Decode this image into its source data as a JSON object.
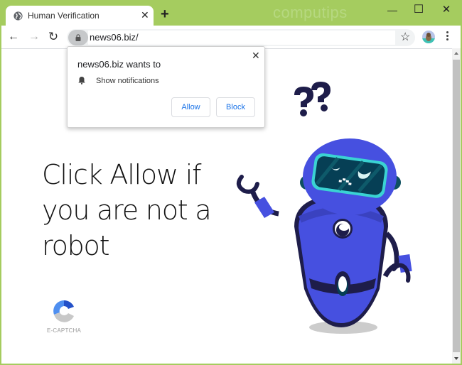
{
  "browser": {
    "tab": {
      "title": "Human Verification",
      "close_glyph": "✕",
      "favicon": "globe-icon"
    },
    "new_tab_glyph": "+",
    "watermark": "computips",
    "window_controls": {
      "minimize": "—",
      "maximize": "☐",
      "close": "✕"
    },
    "nav": {
      "back": "←",
      "forward": "→",
      "reload": "↻"
    },
    "address_bar": {
      "url": "news06.biz/",
      "lock_icon": "lock-icon"
    },
    "bookmark_glyph": "☆"
  },
  "popup": {
    "title": "news06.biz wants to",
    "permission": "Show notifications",
    "allow_label": "Allow",
    "block_label": "Block",
    "close_glyph": "✕"
  },
  "page": {
    "headline": "Click Allow if you are not a robot",
    "captcha_label": "E-CAPTCHA",
    "colors": {
      "robot_body": "#4650e0",
      "robot_dark": "#1e1d4a",
      "visor": "#063f55",
      "visor_rim": "#3ad3d3",
      "captcha_blue_dark": "#2451c8",
      "captcha_blue_light": "#4f8ff0",
      "captcha_gray": "#c8c8c8"
    }
  }
}
